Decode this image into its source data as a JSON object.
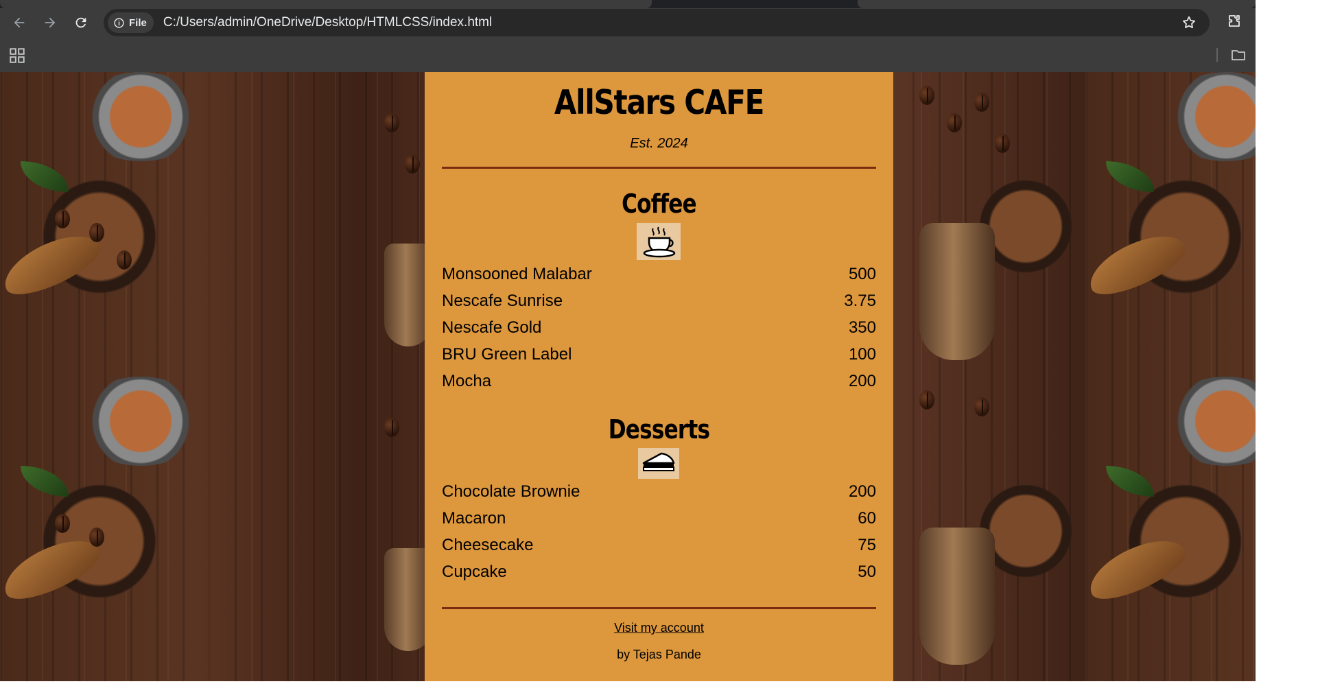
{
  "browser": {
    "site_chip_label": "File",
    "url": "C:/Users/admin/OneDrive/Desktop/HTMLCSS/index.html"
  },
  "page": {
    "title": "AllStars CAFE",
    "tagline": "Est. 2024",
    "sections": [
      {
        "title": "Coffee",
        "icon": "coffee-cup-icon",
        "items": [
          {
            "name": "Monsooned Malabar",
            "price": "500"
          },
          {
            "name": "Nescafe Sunrise",
            "price": "3.75"
          },
          {
            "name": "Nescafe Gold",
            "price": "350"
          },
          {
            "name": "BRU Green Label",
            "price": "100"
          },
          {
            "name": "Mocha",
            "price": "200"
          }
        ]
      },
      {
        "title": "Desserts",
        "icon": "pie-slice-icon",
        "items": [
          {
            "name": "Chocolate Brownie",
            "price": "200"
          },
          {
            "name": "Macaron",
            "price": "60"
          },
          {
            "name": "Cheesecake",
            "price": "75"
          },
          {
            "name": "Cupcake",
            "price": "50"
          }
        ]
      }
    ],
    "footer": {
      "link_text": "Visit my account",
      "byline": "by Tejas Pande"
    }
  },
  "colors": {
    "menu_background": "#dd973d",
    "divider": "#7a2b10",
    "chrome_background": "#3c3c3c"
  }
}
